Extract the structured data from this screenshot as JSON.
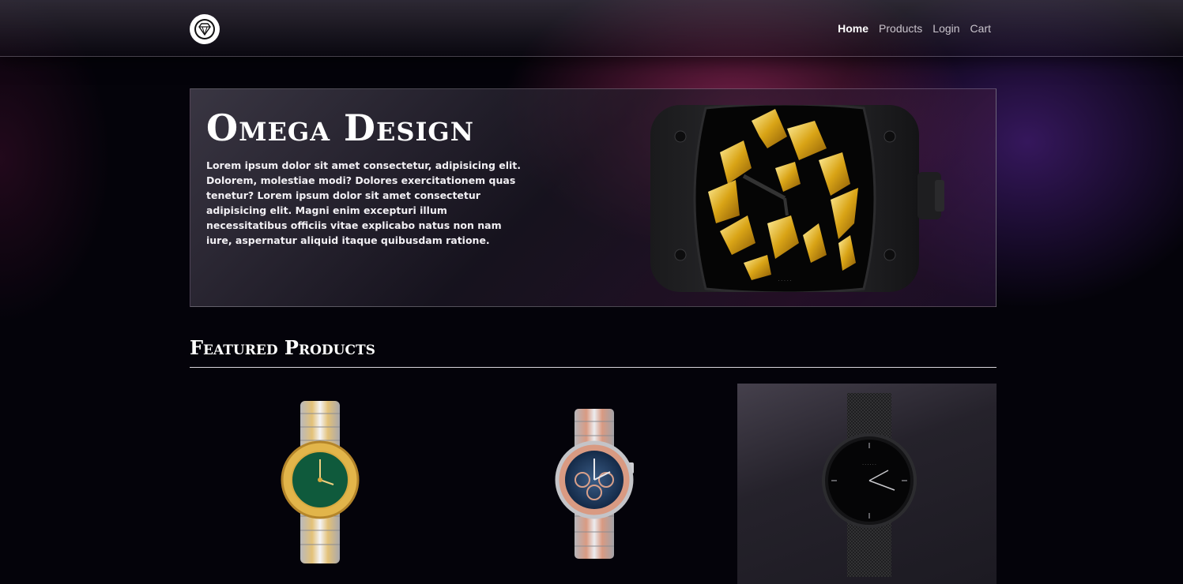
{
  "nav": {
    "logo_icon": "diamond-icon",
    "links": [
      {
        "label": "Home",
        "active": true
      },
      {
        "label": "Products",
        "active": false
      },
      {
        "label": "Login",
        "active": false
      },
      {
        "label": "Cart",
        "active": false
      }
    ]
  },
  "hero": {
    "title": "Omega Design",
    "text": "Lorem ipsum dolor sit amet consectetur, adipisicing elit. Dolorem, molestiae modi? Dolores exercitationem quas tenetur? Lorem ipsum dolor sit amet consectetur adipisicing elit. Magni enim excepturi illum necessitatibus officiis vitae explicabo natus non nam iure, aspernatur aliquid itaque quibusdam ratione."
  },
  "featured": {
    "title": "Featured Products",
    "products": [
      {
        "image": "gold-silver-green-dial-watch"
      },
      {
        "image": "rose-gold-chronograph-watch"
      },
      {
        "image": "black-mesh-strap-watch"
      }
    ]
  },
  "colors": {
    "background": "#04030a",
    "accent_pink": "#96285a",
    "accent_purple": "#461e78"
  }
}
